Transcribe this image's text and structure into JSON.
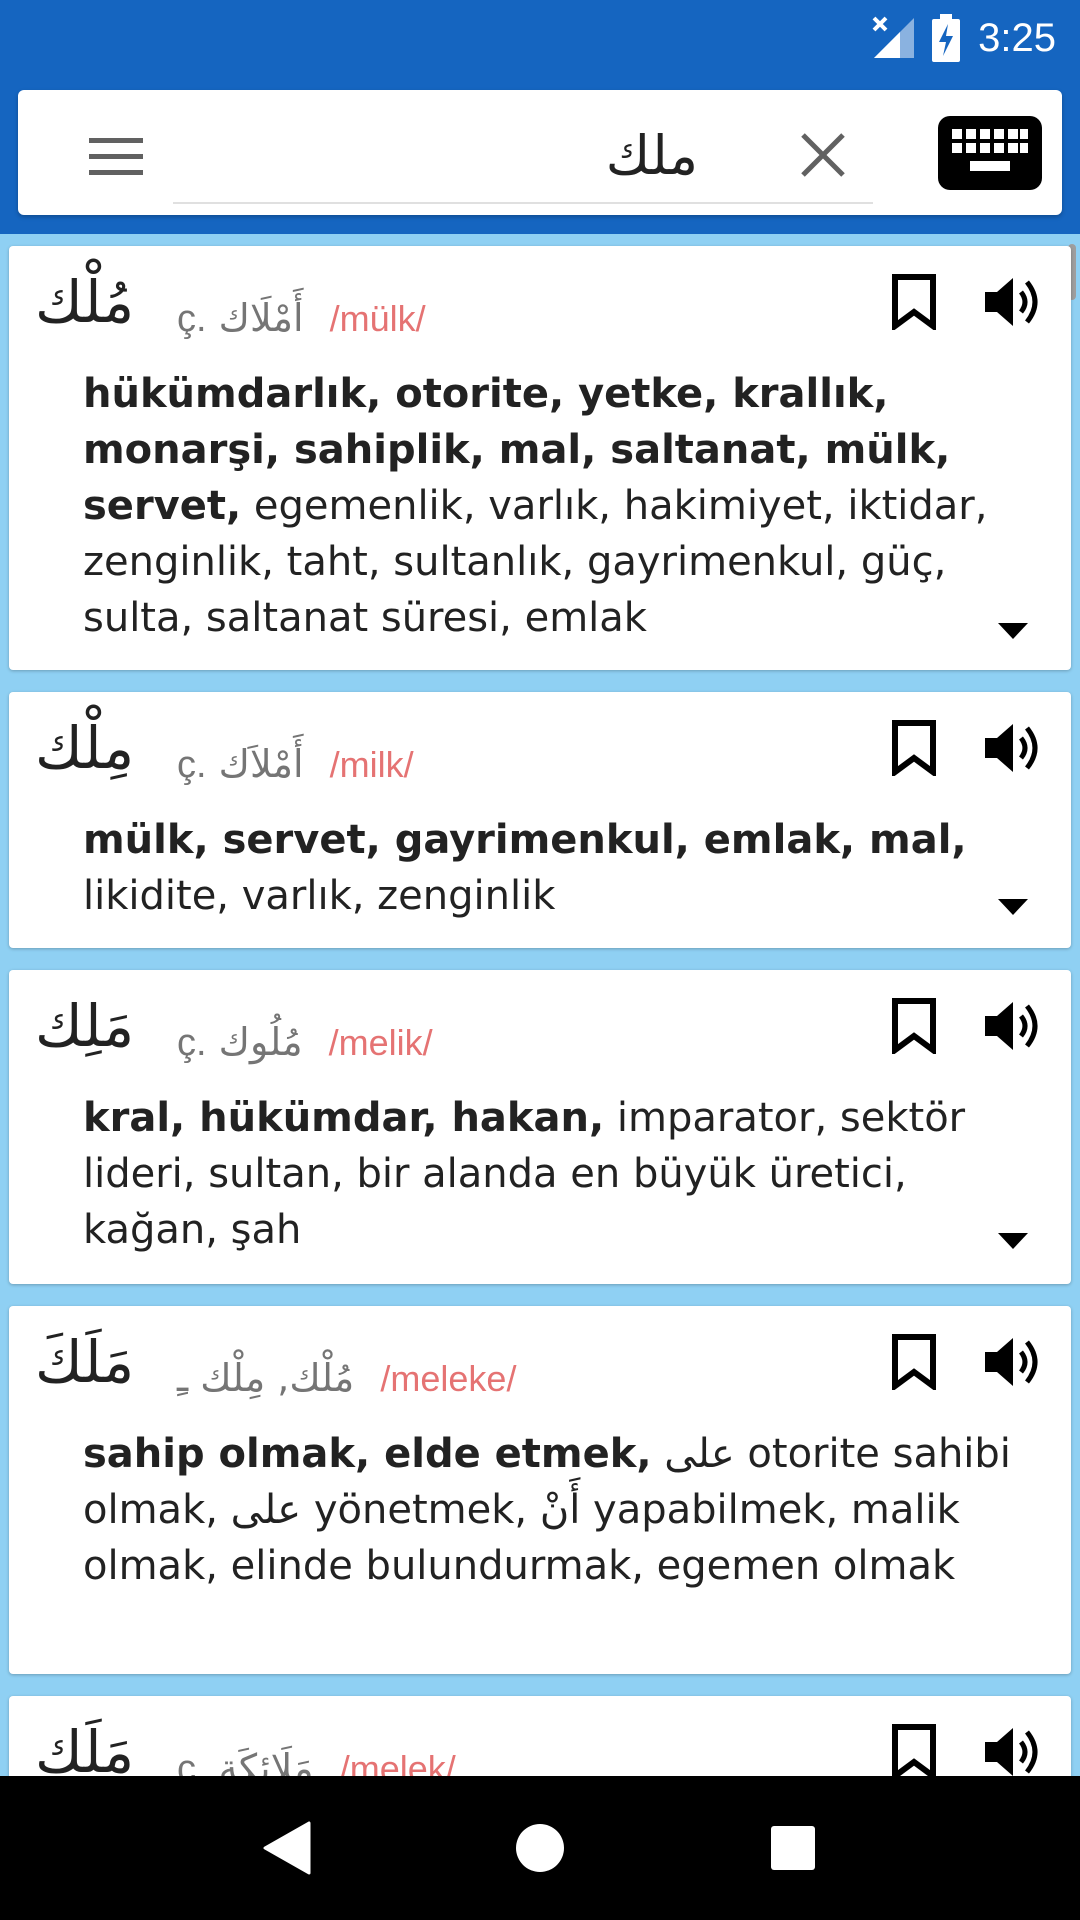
{
  "status": {
    "time": "3:25"
  },
  "search": {
    "query": "ملك",
    "placeholder": ""
  },
  "results": [
    {
      "headword": "مُلْك",
      "plural_label": "ç.",
      "plural": "أَمْلَاك",
      "translit": "/mülk/",
      "defs_bold": "hükümdarlık, otorite, yetke, krallık, monarşi, sahiplik, mal, saltanat, mülk, servet,",
      "defs_rest": "egemenlik, varlık, hakimiyet, iktidar, zenginlik, taht, sultanlık, gayrimenkul, güç, sulta, saltanat süresi, emlak"
    },
    {
      "headword": "مِلْك",
      "plural_label": "ç.",
      "plural": "أَمْلاَك",
      "translit": "/milk/",
      "defs_bold": "mülk, servet, gayrimenkul, emlak, mal,",
      "defs_rest": "likidite, varlık, zenginlik"
    },
    {
      "headword": "مَلِك",
      "plural_label": "ç.",
      "plural": "مُلُوك",
      "translit": "/melik/",
      "defs_bold": "kral, hükümdar, hakan,",
      "defs_rest": "imparator, sektör lideri, sultan, bir alanda en büyük üretici, kağan, şah"
    },
    {
      "headword": "مَلَكَ",
      "plural_label": "",
      "plural": "مُلْك, مِلْك ـِ",
      "translit": "/meleke/",
      "defs_bold": "sahip olmak, elde etmek,",
      "defs_p1": "otorite sahibi olmak,",
      "defs_ar1": "على",
      "defs_p2": "yönetmek,",
      "defs_ar2": "أَنْ",
      "defs_p3": "yapabilmek, malik olmak, elinde bulundurmak, egemen olmak",
      "defs_ar0": "على"
    },
    {
      "headword": "مَلَك",
      "plural_label": "ç.",
      "plural": "مَلَائِكَة",
      "translit": "/melek/"
    }
  ],
  "colors": {
    "appbar": "#1565c0",
    "background": "#8fd0f3",
    "translit": "#e57373"
  }
}
